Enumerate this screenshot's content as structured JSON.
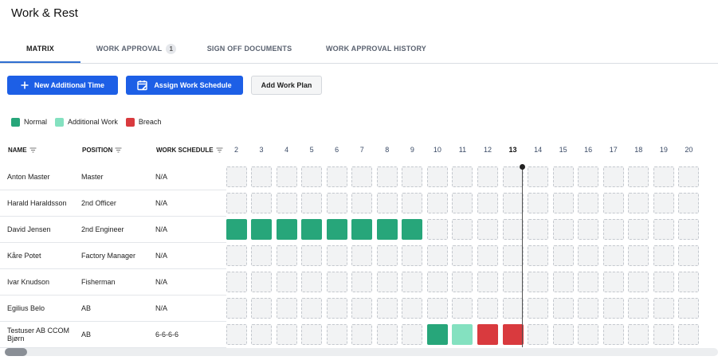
{
  "page": {
    "title": "Work & Rest"
  },
  "tabs": [
    {
      "label": "MATRIX",
      "active": true
    },
    {
      "label": "WORK APPROVAL",
      "count": "1"
    },
    {
      "label": "SIGN OFF DOCUMENTS"
    },
    {
      "label": "WORK APPROVAL HISTORY"
    }
  ],
  "actions": {
    "new_additional_time": "New Additional Time",
    "assign_work_schedule": "Assign Work Schedule",
    "add_work_plan": "Add Work Plan"
  },
  "legend": [
    {
      "label": "Normal",
      "color": "#27a67a"
    },
    {
      "label": "Additional Work",
      "color": "#84e1c0"
    },
    {
      "label": "Breach",
      "color": "#d93a3e"
    }
  ],
  "table": {
    "columns": {
      "name": "NAME",
      "position": "POSITION",
      "schedule": "WORK SCHEDULE"
    },
    "days": [
      "2",
      "3",
      "4",
      "5",
      "6",
      "7",
      "8",
      "9",
      "10",
      "11",
      "12",
      "13",
      "14",
      "15",
      "16",
      "17",
      "18",
      "19",
      "20"
    ],
    "today": "13",
    "rows": [
      {
        "name": "Anton Master",
        "position": "Master",
        "schedule": "N/A",
        "status": {}
      },
      {
        "name": "Harald Haraldsson",
        "position": "2nd Officer",
        "schedule": "N/A",
        "status": {}
      },
      {
        "name": "David Jensen",
        "position": "2nd Engineer",
        "schedule": "N/A",
        "status": {
          "1": "normal",
          "2": "normal",
          "3": "normal",
          "4": "normal",
          "5": "normal",
          "6": "normal",
          "7": "normal",
          "8": "normal",
          "9": "normal"
        }
      },
      {
        "name": "Kåre Potet",
        "position": "Factory Manager",
        "schedule": "N/A",
        "status": {}
      },
      {
        "name": "Ivar Knudson",
        "position": "Fisherman",
        "schedule": "N/A",
        "status": {}
      },
      {
        "name": "Egilius Belo",
        "position": "AB",
        "schedule": "N/A",
        "status": {}
      },
      {
        "name": "Testuser AB CCOM Bjørn",
        "position": "AB",
        "schedule": "6-6-6-6",
        "status": {
          "10": "normal",
          "11": "additional",
          "12": "breach",
          "13": "breach"
        }
      }
    ]
  }
}
